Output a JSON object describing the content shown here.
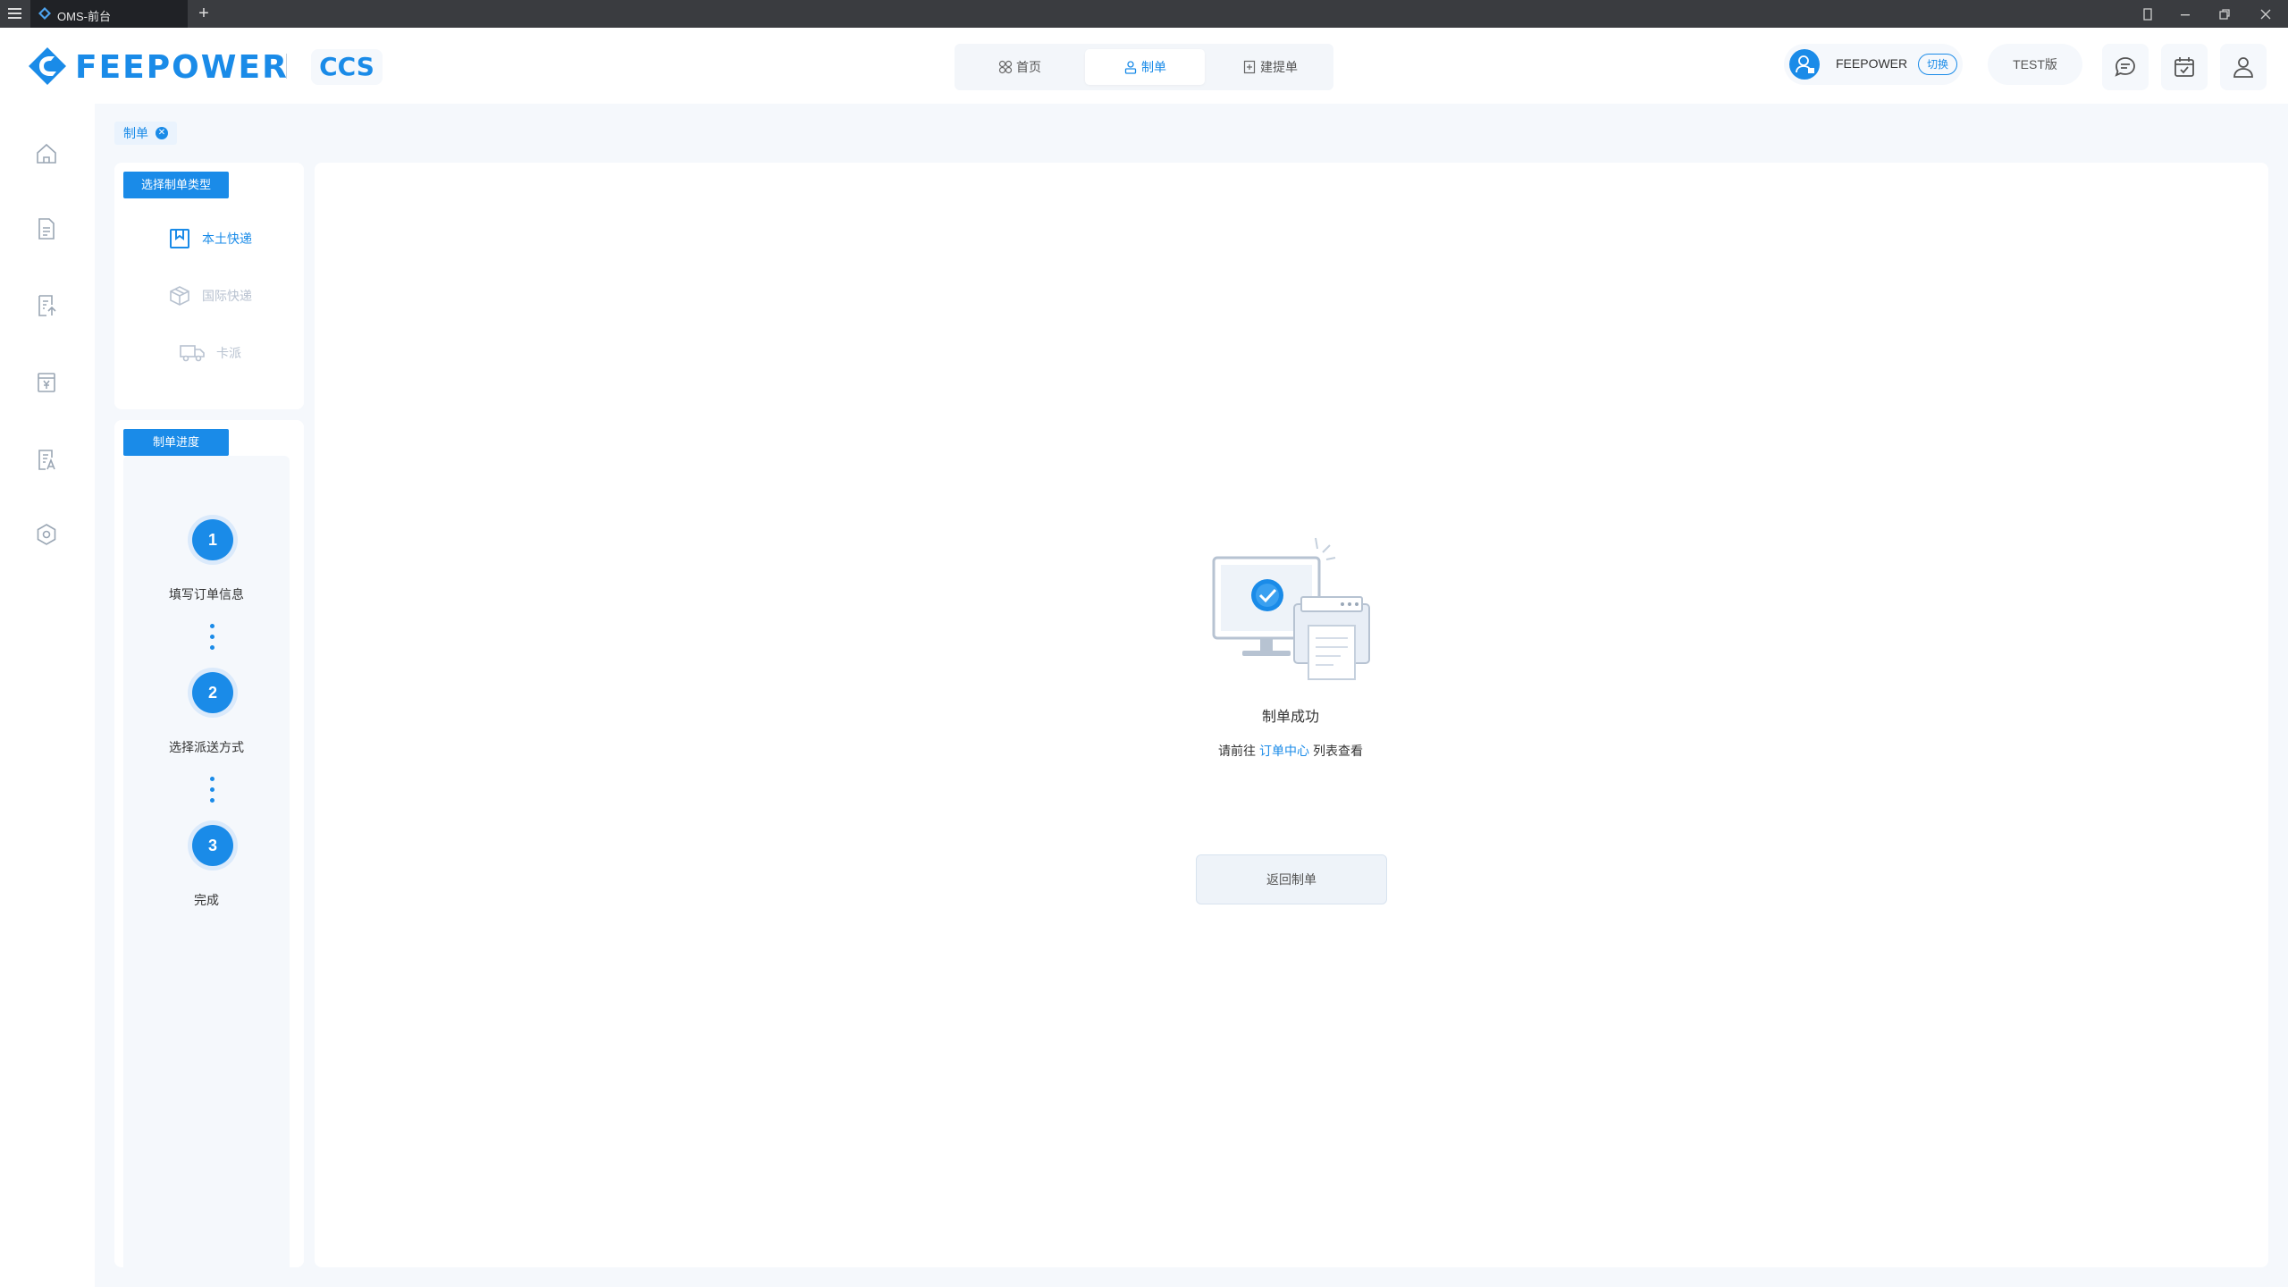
{
  "browser": {
    "tab_title": "OMS-前台",
    "new_tab": "+"
  },
  "header": {
    "logo_text": "FEEPOWER",
    "logo_sub": "CCS",
    "nav_tabs": [
      {
        "label": "首页",
        "icon": "grid-icon"
      },
      {
        "label": "制单",
        "icon": "user-form-icon"
      },
      {
        "label": "建提单",
        "icon": "add-doc-icon"
      }
    ],
    "user_name": "FEEPOWER",
    "switch_label": "切换",
    "env_label": "TEST版",
    "icons": [
      "message-icon",
      "calendar-icon",
      "user-icon"
    ]
  },
  "sidebar": {
    "icons": [
      "home-icon",
      "document-icon",
      "upload-doc-icon",
      "finance-icon",
      "report-icon",
      "settings-icon"
    ]
  },
  "breadcrumb": {
    "label": "制单",
    "close": "✕"
  },
  "type_panel": {
    "title": "选择制单类型",
    "items": [
      {
        "label": "本土快递",
        "state": "active",
        "icon": "bookmark-icon"
      },
      {
        "label": "国际快递",
        "state": "disabled",
        "icon": "box-icon"
      },
      {
        "label": "卡派",
        "state": "disabled",
        "icon": "truck-icon"
      }
    ]
  },
  "progress_panel": {
    "title": "制单进度",
    "steps": [
      {
        "number": "1",
        "label": "填写订单信息"
      },
      {
        "number": "2",
        "label": "选择派送方式"
      },
      {
        "number": "3",
        "label": "完成"
      }
    ]
  },
  "result": {
    "title": "制单成功",
    "desc_prefix": "请前往",
    "desc_link": "订单中心",
    "desc_suffix": "列表查看",
    "back_button": "返回制单"
  },
  "colors": {
    "accent": "#1a8be8",
    "background": "#f5f8fc",
    "disabled": "#b8c2d0"
  }
}
